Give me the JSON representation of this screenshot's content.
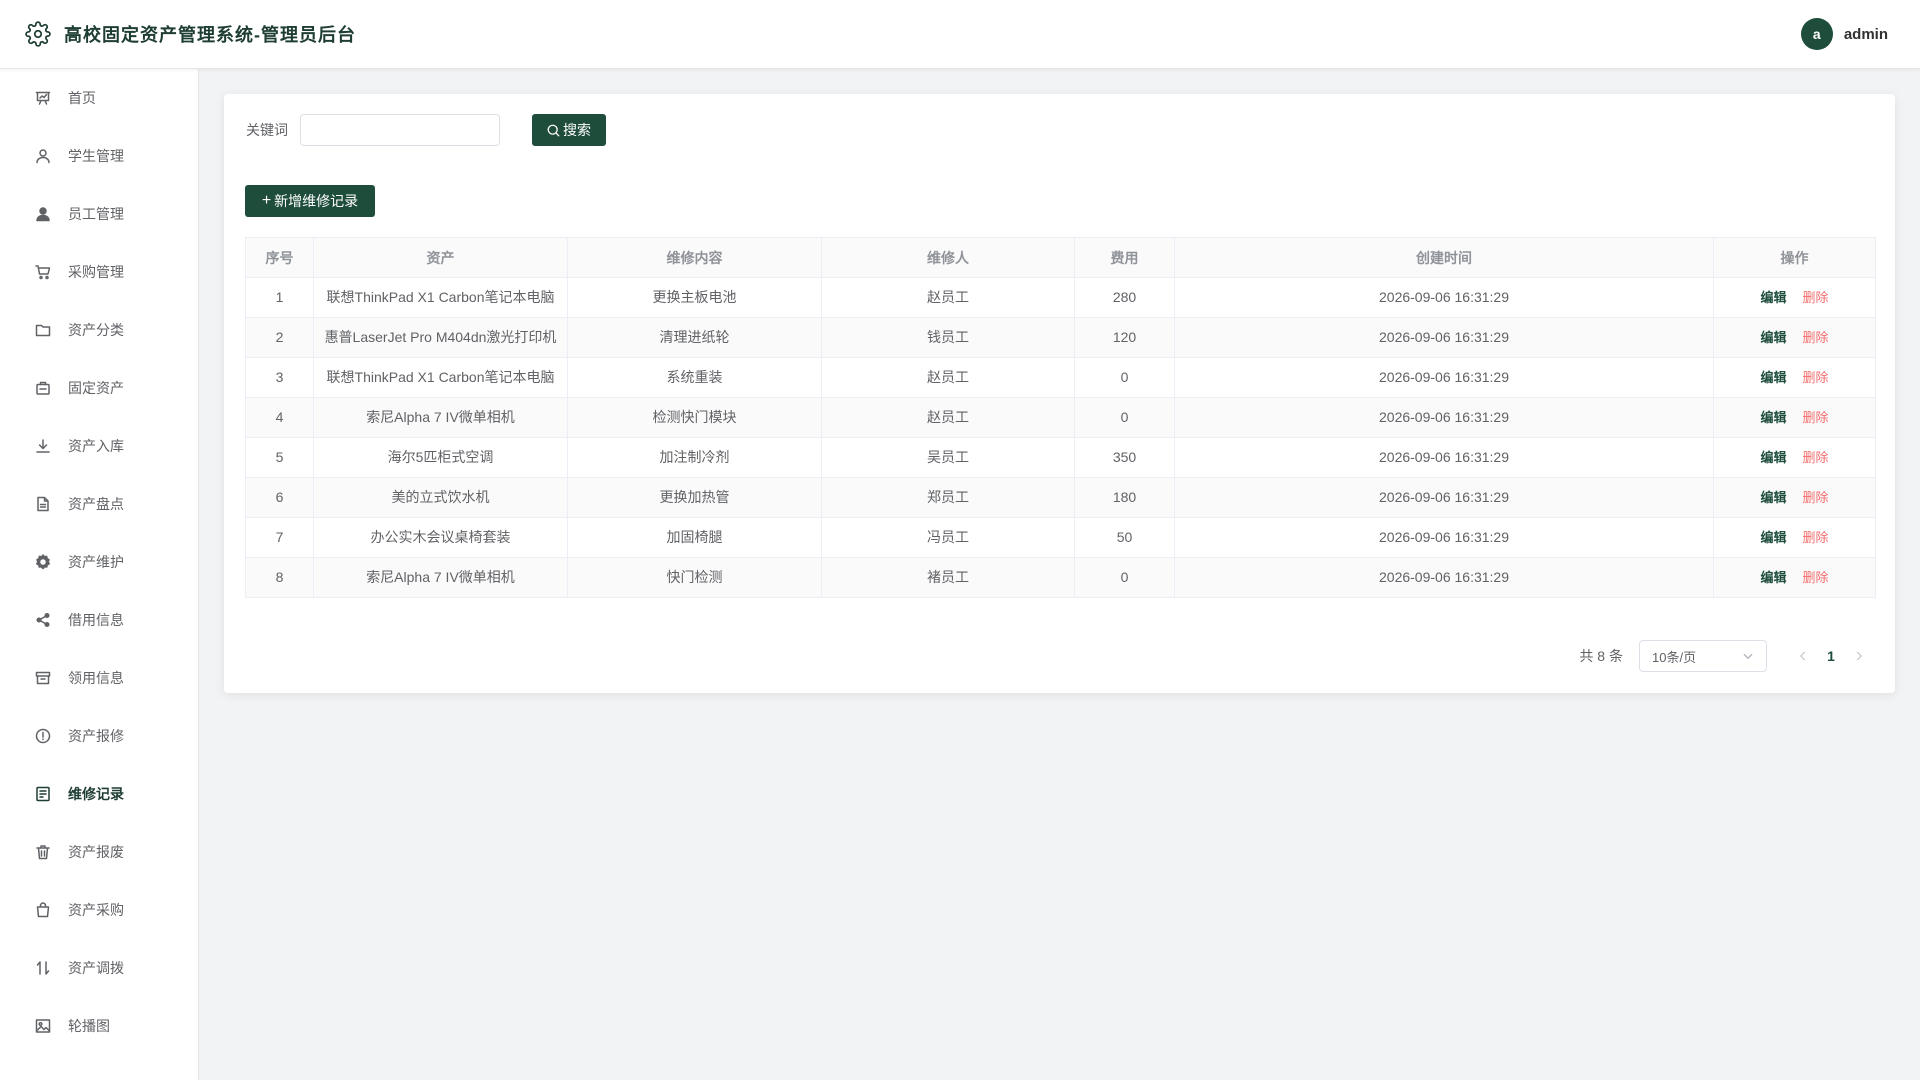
{
  "header": {
    "app_title": "高校固定资产管理系统-管理员后台",
    "avatar_letter": "a",
    "username": "admin",
    "brand_icon": "gear-icon"
  },
  "sidebar": {
    "items": [
      {
        "label": "首页",
        "icon": "chart-board-icon"
      },
      {
        "label": "学生管理",
        "icon": "user-icon"
      },
      {
        "label": "员工管理",
        "icon": "user-filled-icon"
      },
      {
        "label": "采购管理",
        "icon": "shopping-cart-icon"
      },
      {
        "label": "资产分类",
        "icon": "folder-icon"
      },
      {
        "label": "固定资产",
        "icon": "briefcase-icon"
      },
      {
        "label": "资产入库",
        "icon": "download-icon"
      },
      {
        "label": "资产盘点",
        "icon": "document-icon"
      },
      {
        "label": "资产维护",
        "icon": "settings-icon"
      },
      {
        "label": "借用信息",
        "icon": "share-icon"
      },
      {
        "label": "领用信息",
        "icon": "box-icon"
      },
      {
        "label": "资产报修",
        "icon": "warning-icon"
      },
      {
        "label": "维修记录",
        "icon": "list-icon",
        "active": true
      },
      {
        "label": "资产报废",
        "icon": "trash-icon"
      },
      {
        "label": "资产采购",
        "icon": "shopping-bag-icon"
      },
      {
        "label": "资产调拨",
        "icon": "sort-icon"
      },
      {
        "label": "轮播图",
        "icon": "picture-icon"
      }
    ]
  },
  "search": {
    "label": "关键词",
    "value": "",
    "placeholder": "",
    "button_label": "搜索"
  },
  "toolbar": {
    "add_label": "新增维修记录"
  },
  "table": {
    "columns": [
      "序号",
      "资产",
      "维修内容",
      "维修人",
      "费用",
      "创建时间",
      "操作"
    ],
    "rows": [
      {
        "index": "1",
        "asset": "联想ThinkPad X1 Carbon笔记本电脑",
        "content": "更换主板电池",
        "repairer": "赵员工",
        "cost": "280",
        "created": "2026-09-06 16:31:29"
      },
      {
        "index": "2",
        "asset": "惠普LaserJet Pro M404dn激光打印机",
        "content": "清理进纸轮",
        "repairer": "钱员工",
        "cost": "120",
        "created": "2026-09-06 16:31:29"
      },
      {
        "index": "3",
        "asset": "联想ThinkPad X1 Carbon笔记本电脑",
        "content": "系统重装",
        "repairer": "赵员工",
        "cost": "0",
        "created": "2026-09-06 16:31:29"
      },
      {
        "index": "4",
        "asset": "索尼Alpha 7 IV微单相机",
        "content": "检测快门模块",
        "repairer": "赵员工",
        "cost": "0",
        "created": "2026-09-06 16:31:29"
      },
      {
        "index": "5",
        "asset": "海尔5匹柜式空调",
        "content": "加注制冷剂",
        "repairer": "吴员工",
        "cost": "350",
        "created": "2026-09-06 16:31:29"
      },
      {
        "index": "6",
        "asset": "美的立式饮水机",
        "content": "更换加热管",
        "repairer": "郑员工",
        "cost": "180",
        "created": "2026-09-06 16:31:29"
      },
      {
        "index": "7",
        "asset": "办公实木会议桌椅套装",
        "content": "加固椅腿",
        "repairer": "冯员工",
        "cost": "50",
        "created": "2026-09-06 16:31:29"
      },
      {
        "index": "8",
        "asset": "索尼Alpha 7 IV微单相机",
        "content": "快门检测",
        "repairer": "褚员工",
        "cost": "0",
        "created": "2026-09-06 16:31:29"
      }
    ],
    "edit_label": "编辑",
    "delete_label": "删除"
  },
  "pagination": {
    "total_text": "共 8 条",
    "page_size": "10条/页",
    "current_page": "1",
    "prev_icon": "chevron-left-icon",
    "next_icon": "chevron-right-icon"
  },
  "colors": {
    "primary": "#1e4d3c",
    "danger": "#f56c6c",
    "background": "#f2f3f5"
  }
}
